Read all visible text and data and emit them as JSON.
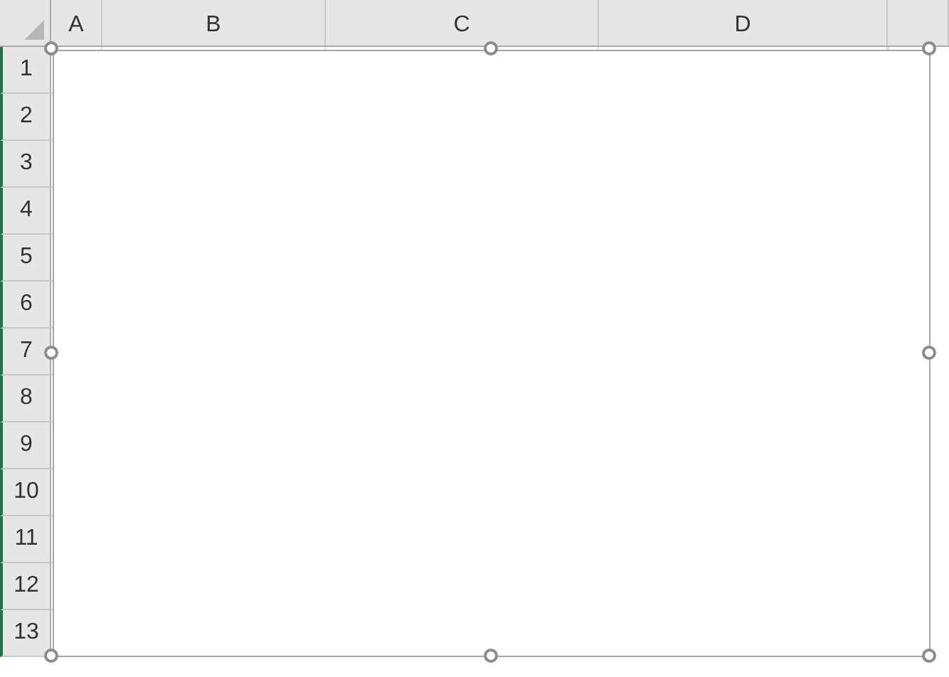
{
  "columns": [
    "A",
    "B",
    "C",
    "D"
  ],
  "rows": [
    "1",
    "2",
    "3",
    "4",
    "5",
    "6",
    "7",
    "8",
    "9",
    "10",
    "11",
    "12",
    "13"
  ],
  "shape": {
    "selected": true
  }
}
